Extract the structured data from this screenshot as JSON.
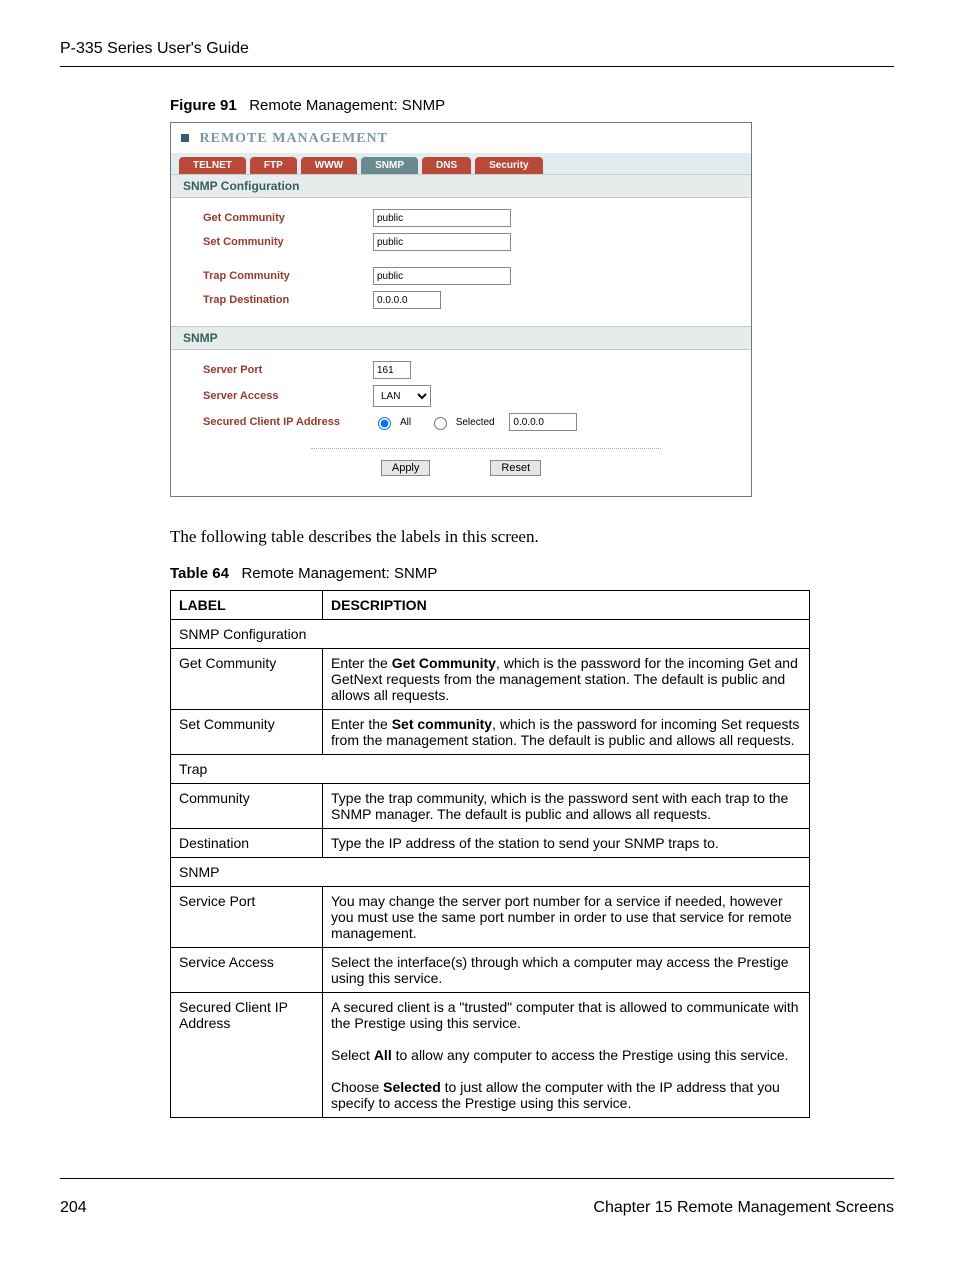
{
  "header": {
    "title": "P-335 Series User's Guide"
  },
  "figure": {
    "label": "Figure 91",
    "title": "Remote Management: SNMP"
  },
  "screenshot": {
    "title": "REMOTE MANAGEMENT",
    "tabs": [
      "TELNET",
      "FTP",
      "WWW",
      "SNMP",
      "DNS",
      "Security"
    ],
    "active_tab": "SNMP",
    "sections": {
      "snmp_conf": {
        "title": "SNMP Configuration",
        "fields": {
          "get_community": {
            "label": "Get Community",
            "value": "public"
          },
          "set_community": {
            "label": "Set Community",
            "value": "public"
          },
          "trap_community": {
            "label": "Trap Community",
            "value": "public"
          },
          "trap_destination": {
            "label": "Trap Destination",
            "value": "0.0.0.0"
          }
        }
      },
      "snmp": {
        "title": "SNMP",
        "fields": {
          "server_port": {
            "label": "Server Port",
            "value": "161"
          },
          "server_access": {
            "label": "Server Access",
            "value": "LAN"
          },
          "secured_ip": {
            "label": "Secured Client IP Address",
            "all_label": "All",
            "selected_label": "Selected",
            "ip": "0.0.0.0"
          }
        }
      }
    },
    "buttons": {
      "apply": "Apply",
      "reset": "Reset"
    }
  },
  "intro": "The following table describes the labels in this screen.",
  "table_caption": {
    "label": "Table 64",
    "title": "Remote Management: SNMP"
  },
  "table": {
    "headers": {
      "label": "LABEL",
      "description": "DESCRIPTION"
    },
    "rows": [
      {
        "label": "SNMP Configuration",
        "span": true
      },
      {
        "label": "Get Community",
        "desc_html": "Enter the <b>Get Community</b>, which is the password for the incoming Get and GetNext requests from the management station. The default is public and allows all requests."
      },
      {
        "label": "Set Community",
        "desc_html": "Enter the <b>Set community</b>, which is the password for incoming Set requests from the management station. The default is public and allows all requests."
      },
      {
        "label": "Trap",
        "span": true
      },
      {
        "label": "Community",
        "desc": "Type the trap community, which is the password sent with each trap to the SNMP manager. The default is public and allows all requests."
      },
      {
        "label": "Destination",
        "desc": "Type the IP address of the station to send your SNMP traps to."
      },
      {
        "label": "SNMP",
        "span": true
      },
      {
        "label": "Service Port",
        "desc": "You may change the server port number for a service if needed, however you must use the same port number in order to use that service for remote management."
      },
      {
        "label": "Service Access",
        "desc": "Select the interface(s) through which a computer may access the Prestige using this service."
      },
      {
        "label": "Secured Client IP Address",
        "desc_html": "A secured client is a \"trusted\" computer that is allowed to communicate with the Prestige using this service.<br><br>Select <b>All</b> to allow any computer to access the Prestige using this service.<br><br>Choose <b>Selected</b> to just allow the computer with the IP address that you specify to access the Prestige using this service."
      }
    ]
  },
  "footer": {
    "page": "204",
    "chapter": "Chapter 15 Remote Management Screens"
  }
}
